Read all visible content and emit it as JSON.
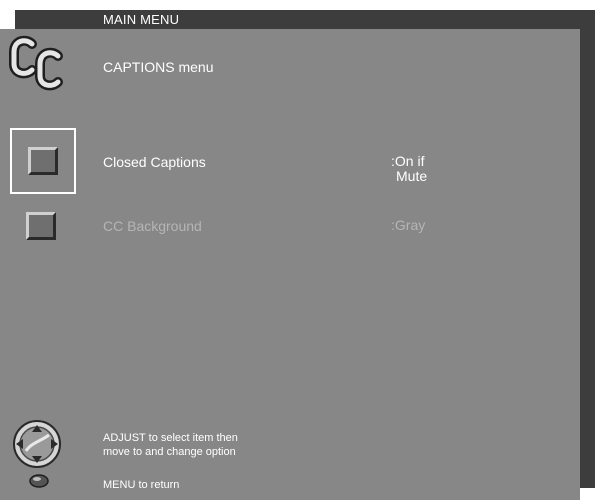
{
  "menu": {
    "title": "MAIN MENU",
    "header_icon": "cc-icon",
    "header_label": "CAPTIONS menu"
  },
  "options": [
    {
      "label": "Closed Captions",
      "value_lines": [
        ":On if",
        "Mute"
      ],
      "icon": "square-icon",
      "selected": true
    },
    {
      "label": "CC Background",
      "value_lines": [
        ":Gray"
      ],
      "icon": "square-icon",
      "selected": false
    }
  ],
  "help": {
    "adjust_lines": [
      "ADJUST to select item then",
      "move to and change option"
    ],
    "adjust_icon": "joystick-icon",
    "menu_text": "MENU to return",
    "menu_icon": "menu-button-icon"
  },
  "colors": {
    "panel": "#878787",
    "frame": "#3d3d3d",
    "text": "#ffffff",
    "disabled_text": "#b5b5b5"
  }
}
